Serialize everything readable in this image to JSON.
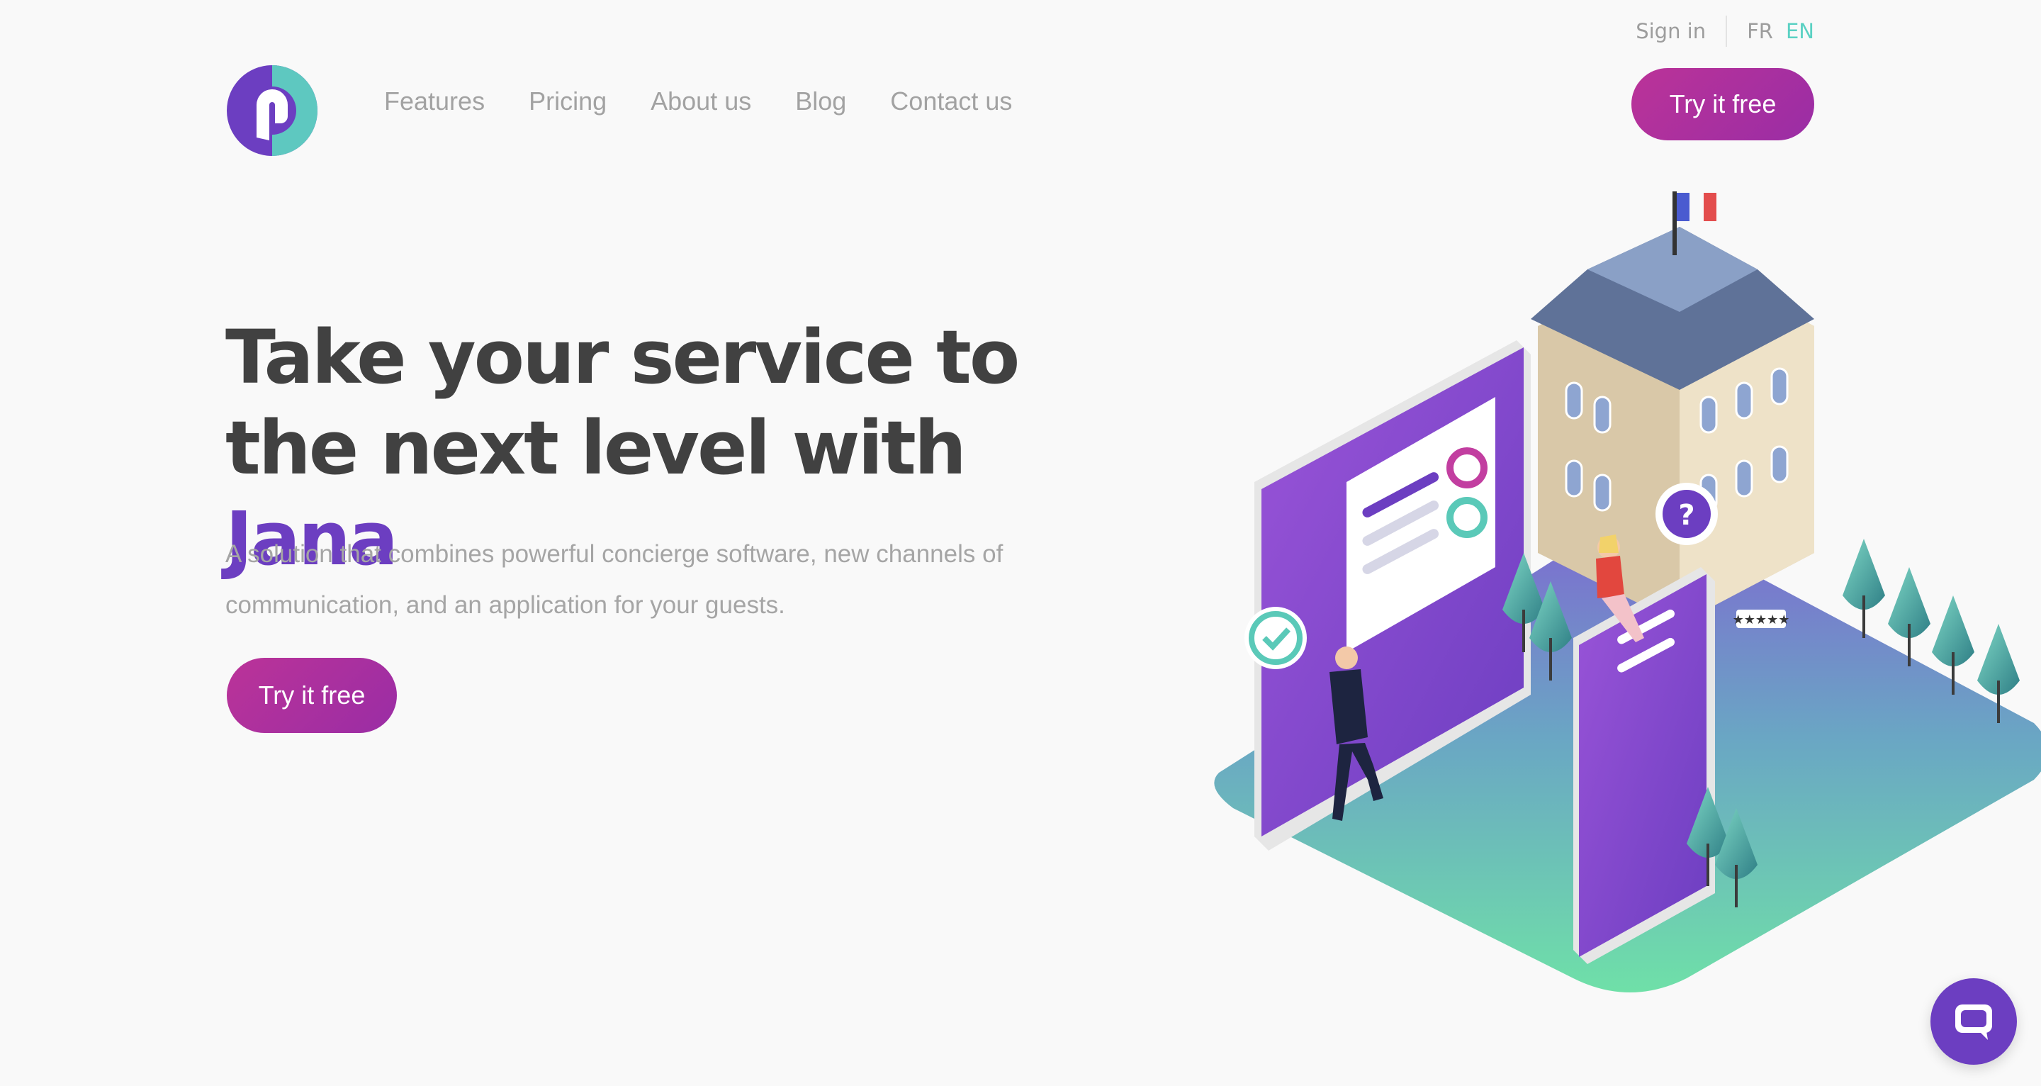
{
  "header": {
    "sign_in": "Sign in",
    "lang_fr": "FR",
    "lang_en": "EN",
    "nav": [
      "Features",
      "Pricing",
      "About us",
      "Blog",
      "Contact us"
    ],
    "cta": "Try it free"
  },
  "hero": {
    "title_main": "Take your service to the next level with ",
    "title_accent": "Jana",
    "subtitle": "A solution that combines powerful concierge software, new channels of communication, and an application for your guests.",
    "cta": "Try it free"
  },
  "illustration": {
    "hotel_stars": "★★★★★"
  },
  "colors": {
    "brand_purple": "#6c3ec1",
    "cta_magenta": "#b02f9f",
    "accent_teal": "#5ad1c3"
  },
  "icons": {
    "logo": "jana-logo-icon",
    "chat": "chat-bubble-icon"
  }
}
